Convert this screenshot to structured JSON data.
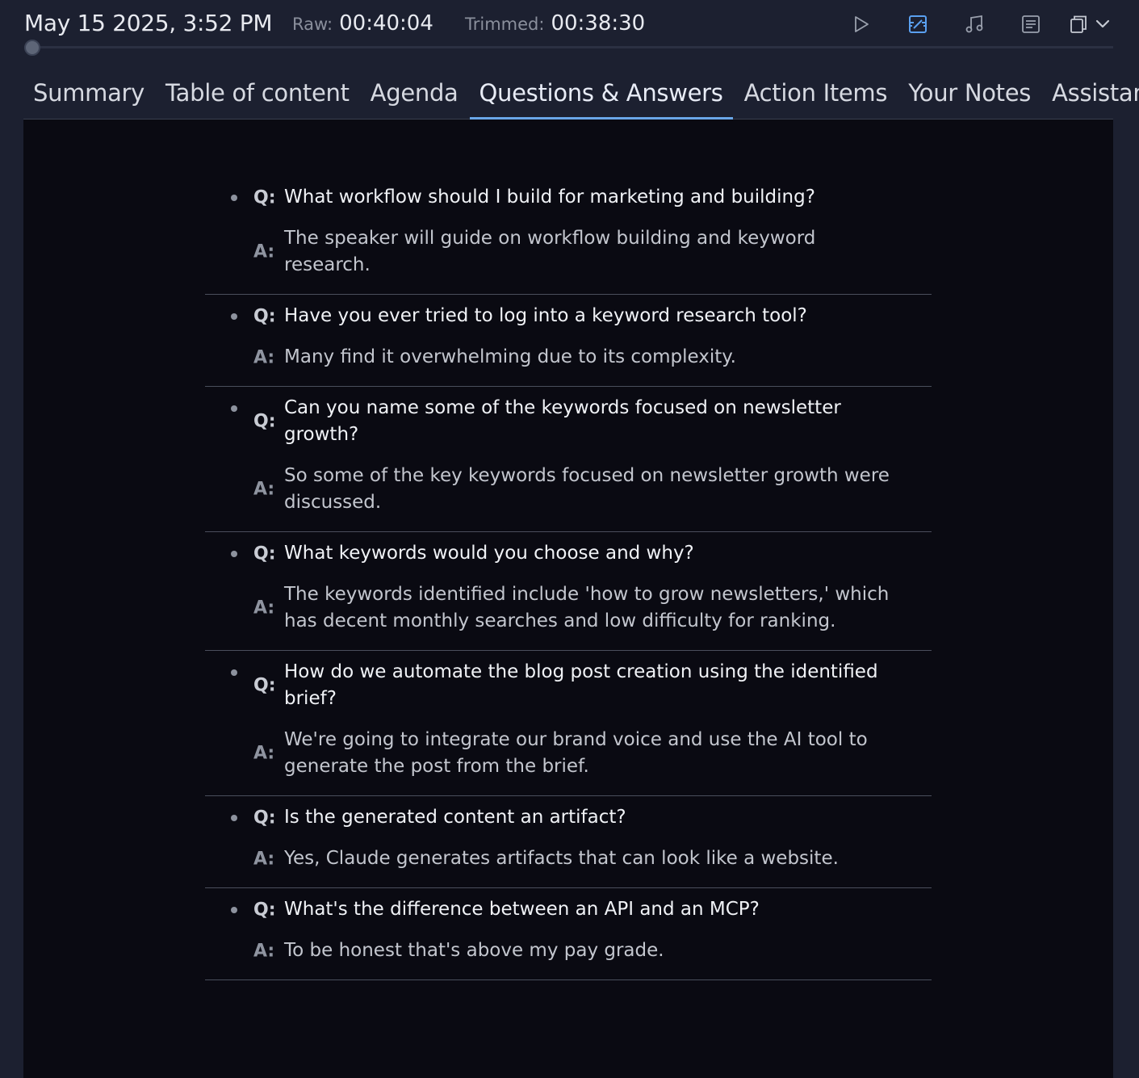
{
  "header": {
    "date": "May 15 2025, 3:52 PM",
    "raw_label": "Raw:",
    "raw_value": "00:40:04",
    "trimmed_label": "Trimmed:",
    "trimmed_value": "00:38:30"
  },
  "toolbar": {
    "icons": [
      "play-icon",
      "chapters-icon",
      "music-icon",
      "document-icon",
      "copy-icon",
      "chevron-down-icon"
    ],
    "accent": "#5aa0f0"
  },
  "tabs": [
    {
      "label": "Summary"
    },
    {
      "label": "Table of content"
    },
    {
      "label": "Agenda"
    },
    {
      "label": "Questions & Answers"
    },
    {
      "label": "Action Items"
    },
    {
      "label": "Your Notes"
    },
    {
      "label": "Assistant"
    }
  ],
  "active_tab": "Questions & Answers",
  "qa_labels": {
    "q": "Q:",
    "a": "A:"
  },
  "qa": [
    {
      "q": "What workflow should I build for marketing and building?",
      "a": "The speaker will guide on workflow building and keyword research."
    },
    {
      "q": "Have you ever tried to log into a keyword research tool?",
      "a": "Many find it overwhelming due to its complexity."
    },
    {
      "q": "Can you name some of the keywords focused on newsletter growth?",
      "a": "So some of the key keywords focused on newsletter growth were discussed."
    },
    {
      "q": "What keywords would you choose and why?",
      "a": "The keywords identified include 'how to grow newsletters,' which has decent monthly searches and low difficulty for ranking."
    },
    {
      "q": "How do we automate the blog post creation using the identified brief?",
      "a": "We're going to integrate our brand voice and use the AI tool to generate the post from the brief."
    },
    {
      "q": "Is the generated content an artifact?",
      "a": "Yes, Claude generates artifacts that can look like a website."
    },
    {
      "q": "What's the difference between an API and an MCP?",
      "a": "To be honest that's above my pay grade."
    }
  ]
}
